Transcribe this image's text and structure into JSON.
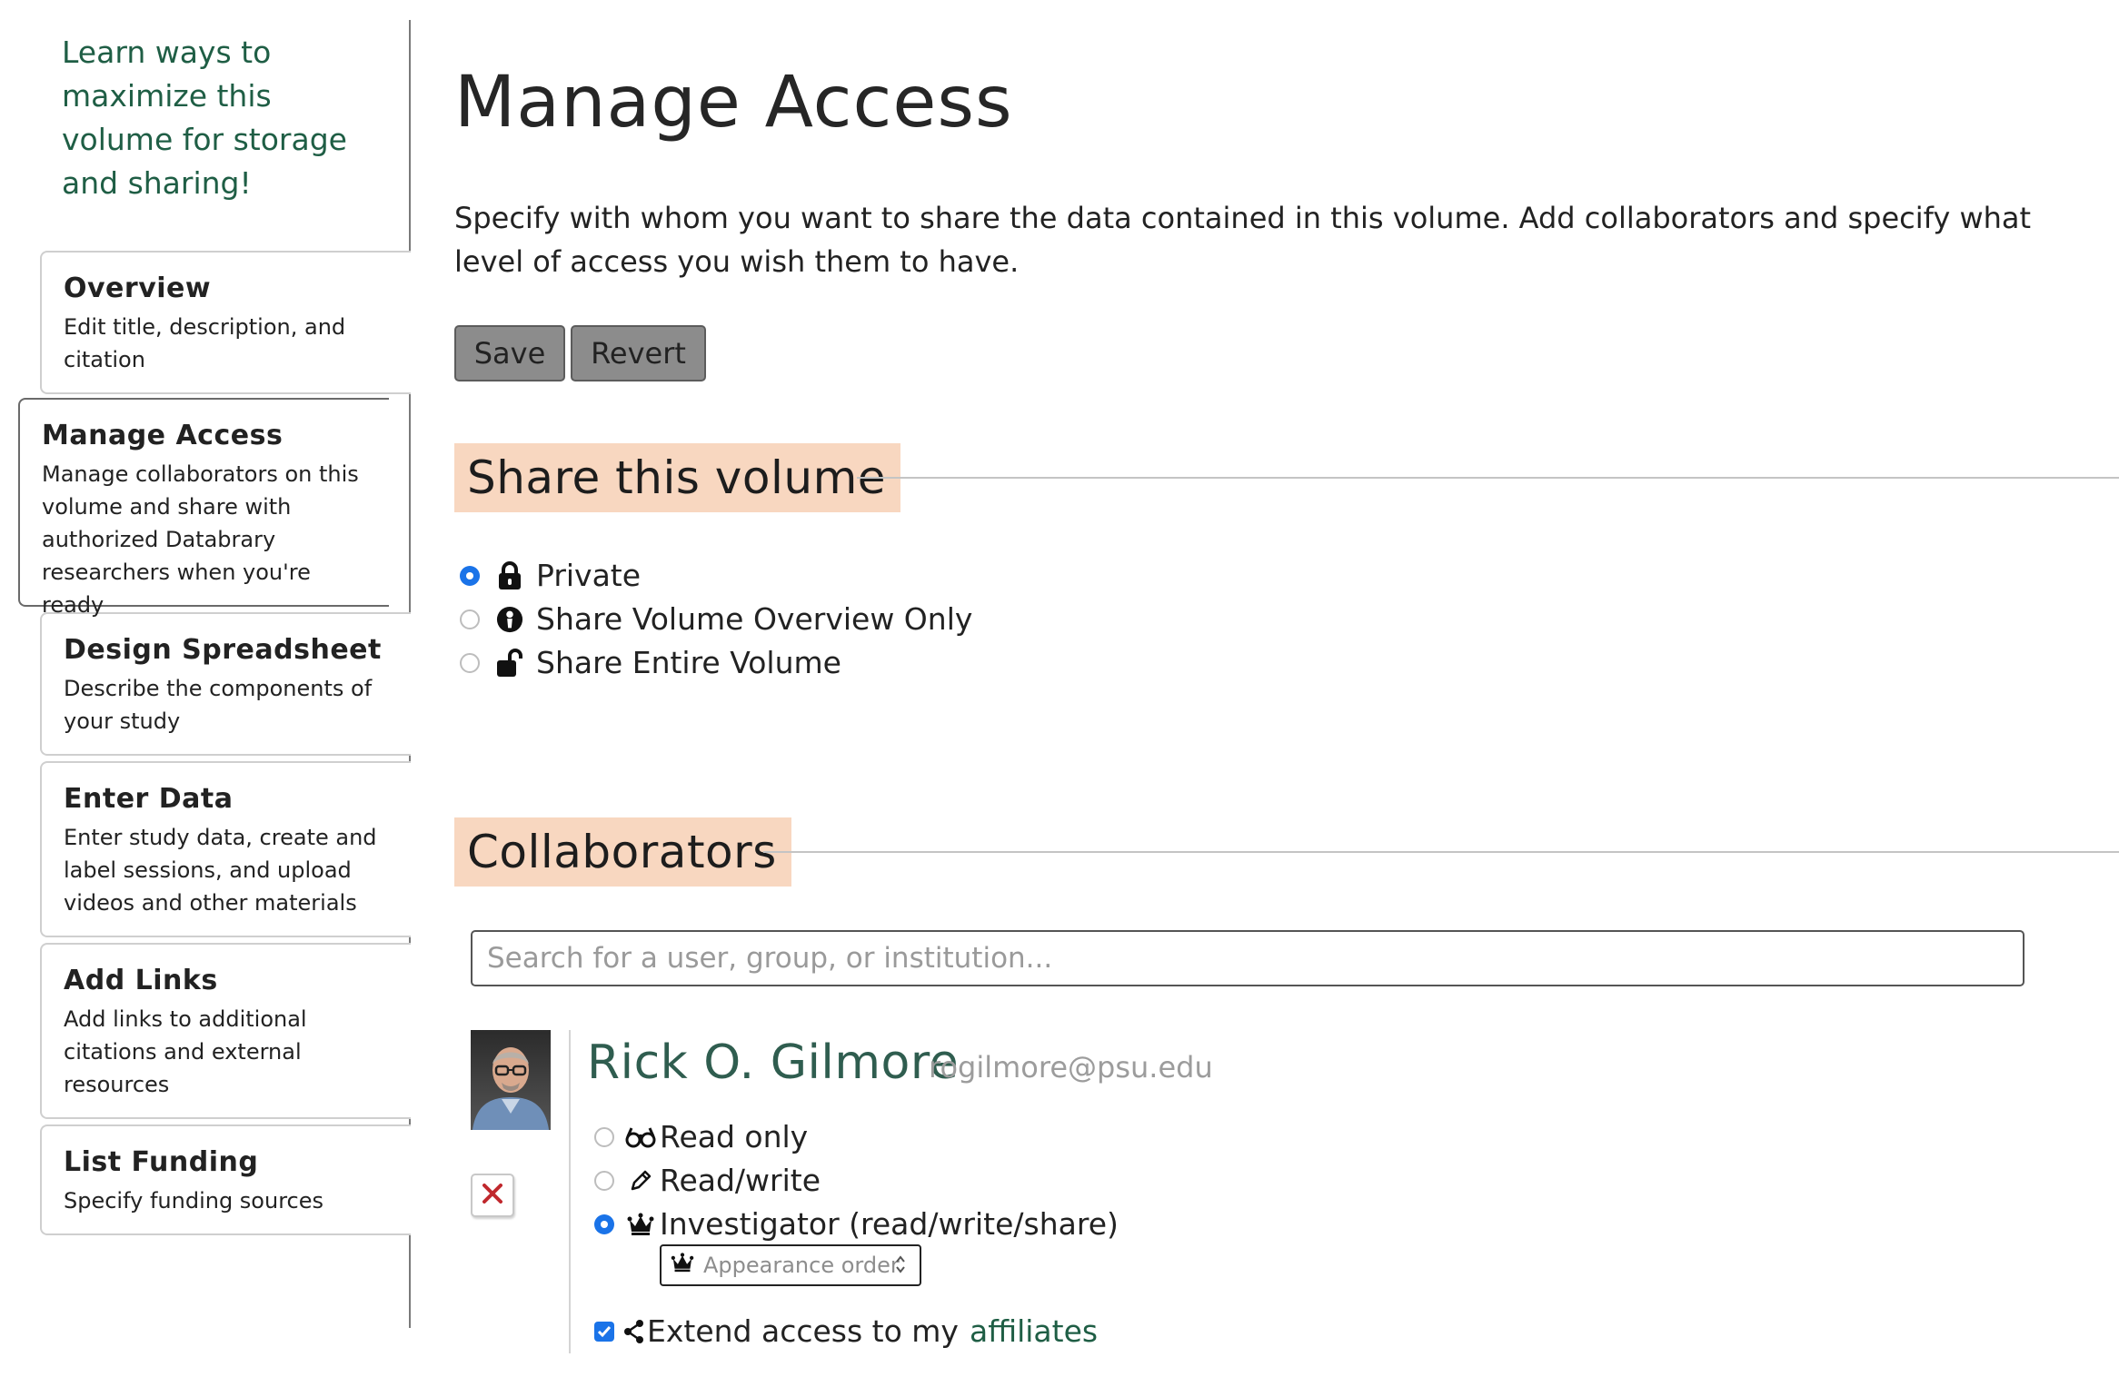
{
  "sidebar": {
    "promo": "Learn ways to maximize this volume for storage and sharing!",
    "items": [
      {
        "title": "Overview",
        "desc": "Edit title, description, and citation"
      },
      {
        "title": "Manage Access",
        "desc": "Manage collaborators on this volume and share with authorized Databrary researchers when you're ready"
      },
      {
        "title": "Design Spreadsheet",
        "desc": "Describe the components of your study"
      },
      {
        "title": "Enter Data",
        "desc": "Enter study data, create and label sessions, and upload videos and other materials"
      },
      {
        "title": "Add Links",
        "desc": "Add links to additional citations and external resources"
      },
      {
        "title": "List Funding",
        "desc": "Specify funding sources"
      }
    ],
    "active_index": 1
  },
  "main": {
    "title": "Manage Access",
    "intro": "Specify with whom you want to share the data contained in this volume. Add collaborators and specify what level of access you wish them to have.",
    "save_label": "Save",
    "revert_label": "Revert"
  },
  "share": {
    "heading": "Share this volume",
    "options": [
      {
        "label": "Private",
        "icon": "lock-icon",
        "selected": true
      },
      {
        "label": "Share Volume Overview Only",
        "icon": "info-circle-icon",
        "selected": false
      },
      {
        "label": "Share Entire Volume",
        "icon": "unlock-icon",
        "selected": false
      }
    ]
  },
  "collaborators": {
    "heading": "Collaborators",
    "search_placeholder": "Search for a user, group, or institution...",
    "entry": {
      "name": "Rick O. Gilmore",
      "email": "rogilmore@psu.edu",
      "permissions": [
        {
          "label": "Read only",
          "icon": "glasses-icon",
          "selected": false
        },
        {
          "label": "Read/write",
          "icon": "pencil-icon",
          "selected": false
        },
        {
          "label": "Investigator (read/write/share)",
          "icon": "crown-icon",
          "selected": true
        }
      ],
      "order_placeholder": "Appearance order",
      "extend_text": "Extend access to my",
      "extend_link": "affiliates",
      "extend_checked": true
    }
  },
  "colors": {
    "accent_green": "#1f5e45",
    "section_bg": "#f8d7c0",
    "radio_blue": "#1a73e8",
    "button_gray": "#8c8c8c"
  }
}
